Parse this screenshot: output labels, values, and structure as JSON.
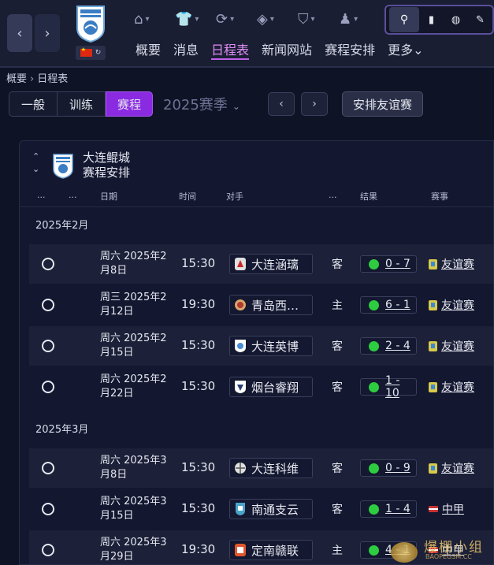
{
  "header": {
    "nav_tabs": [
      "概要",
      "消息",
      "日程表",
      "新闻网站",
      "赛程安排",
      "更多"
    ],
    "active_tab": "日程表",
    "more_chevron": "⌄"
  },
  "breadcrumb": {
    "root": "概要",
    "current": "日程表"
  },
  "toolbar": {
    "segments": [
      "一般",
      "训练",
      "赛程"
    ],
    "active_segment": "赛程",
    "season_label": "2025赛季",
    "arrange_friendly_label": "安排友谊赛"
  },
  "panel": {
    "club_name": "大连鲲城",
    "subtitle": "赛程安排",
    "columns": {
      "c1": "...",
      "c2": "...",
      "date": "日期",
      "time": "时间",
      "opponent": "对手",
      "venue": "...",
      "result": "结果",
      "competition": "赛事"
    },
    "months": [
      "2025年2月",
      "2025年3月"
    ],
    "matches": [
      {
        "date": "周六 2025年2月8日",
        "time": "15:30",
        "opponent": "大连涵璃",
        "venue": "客",
        "result": "0 - 7",
        "competition": "友谊赛"
      },
      {
        "date": "周三 2025年2月12日",
        "time": "19:30",
        "opponent": "青岛西…",
        "venue": "主",
        "result": "6 - 1",
        "competition": "友谊赛"
      },
      {
        "date": "周六 2025年2月15日",
        "time": "15:30",
        "opponent": "大连英博",
        "venue": "客",
        "result": "2 - 4",
        "competition": "友谊赛"
      },
      {
        "date": "周六 2025年2月22日",
        "time": "15:30",
        "opponent": "烟台睿翔",
        "venue": "客",
        "result": "1 - 10",
        "competition": "友谊赛"
      },
      {
        "date": "周六 2025年3月8日",
        "time": "15:30",
        "opponent": "大连科维",
        "venue": "客",
        "result": "0 - 9",
        "competition": "友谊赛"
      },
      {
        "date": "周六 2025年3月15日",
        "time": "15:30",
        "opponent": "南通支云",
        "venue": "客",
        "result": "1 - 4",
        "competition": "中甲"
      },
      {
        "date": "周六 2025年3月29日",
        "time": "19:30",
        "opponent": "定南赣联",
        "venue": "主",
        "result": "4 - 1",
        "competition": "中甲"
      }
    ]
  },
  "watermark": {
    "text": "爆棚小组",
    "sub": "BAOPEGSM.CC"
  },
  "colors": {
    "accent": "#8a2be2",
    "active_tab": "#e08ef5",
    "win_dot": "#2ecc40",
    "background": "#0f1326"
  }
}
